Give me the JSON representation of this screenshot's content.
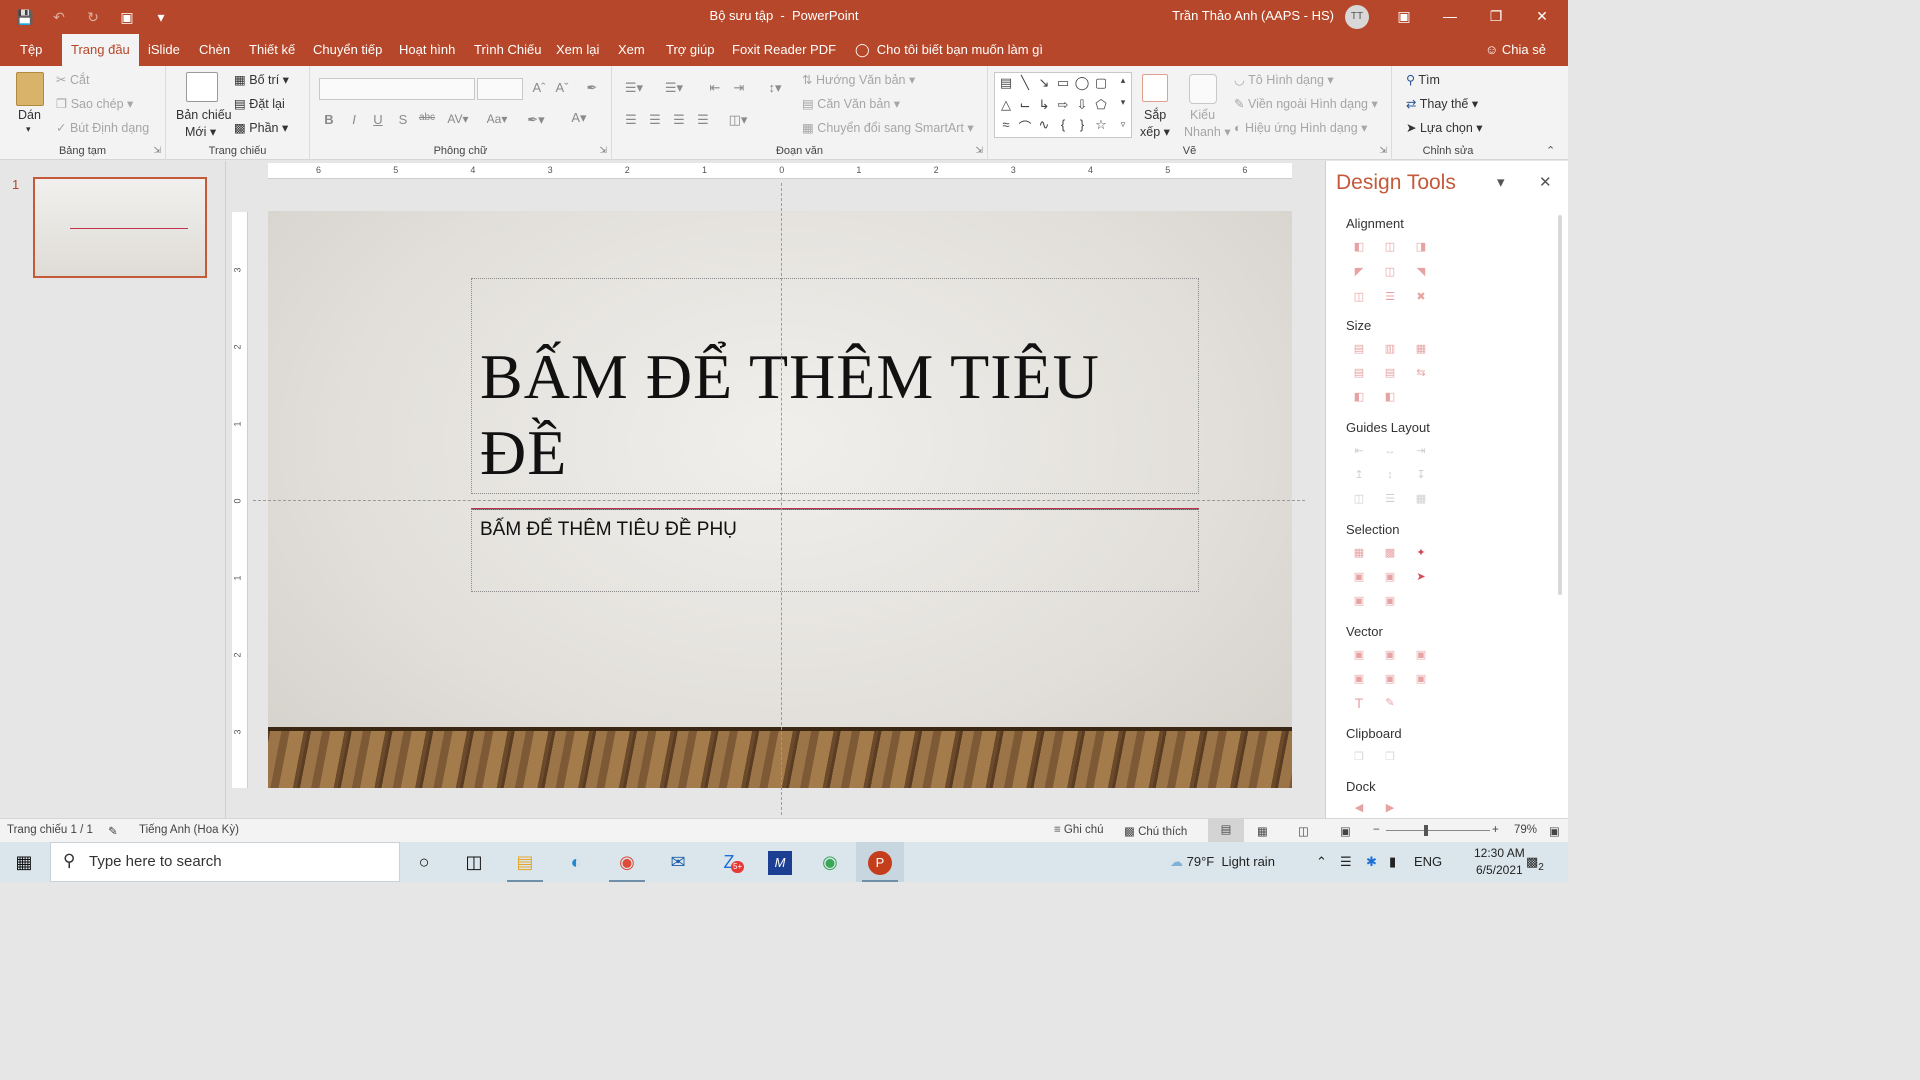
{
  "window": {
    "doc_title": "Bộ sưu tập",
    "app_name": "PowerPoint",
    "title_sep": "  -  ",
    "user_name": "Trần Thảo Anh (AAPS - HS)",
    "user_initials": "TT"
  },
  "tabs": [
    "Tệp",
    "Trang đầu",
    "iSlide",
    "Chèn",
    "Thiết kế",
    "Chuyển tiếp",
    "Hoạt hình",
    "Trình Chiếu",
    "Xem lại",
    "Xem",
    "Trợ giúp",
    "Foxit Reader PDF"
  ],
  "active_tab": "Trang đầu",
  "tell_me": "Cho tôi biết bạn muốn làm gì",
  "share": "Chia sẻ",
  "ribbon": {
    "clipboard": {
      "label": "Bảng tạm",
      "paste": "Dán",
      "cut": "Cắt",
      "copy": "Sao chép",
      "format_painter": "Bút Định dạng"
    },
    "slides": {
      "label": "Trang chiếu",
      "new_slide_1": "Bản chiếu",
      "new_slide_2": "Mới",
      "layout": "Bố trí",
      "reset": "Đặt lại",
      "section": "Phần"
    },
    "font": {
      "label": "Phông chữ"
    },
    "paragraph": {
      "label": "Đoạn văn",
      "text_direction": "Hướng Văn bản",
      "align_text": "Căn Văn bản",
      "smartart": "Chuyển đổi sang SmartArt"
    },
    "drawing": {
      "label": "Vẽ",
      "arrange_1": "Sắp",
      "arrange_2": "xếp",
      "quick_styles_1": "Kiểu",
      "quick_styles_2": "Nhanh",
      "shape_fill": "Tô Hình dạng",
      "shape_outline": "Viền ngoài Hình dạng",
      "shape_effects": "Hiệu ứng Hình dạng"
    },
    "editing": {
      "label": "Chỉnh sửa",
      "find": "Tìm",
      "replace": "Thay thế",
      "select": "Lựa chọn"
    }
  },
  "thumbnails": [
    {
      "number": "1"
    }
  ],
  "slide": {
    "title": "BẤM ĐỂ THÊM TIÊU ĐỀ",
    "subtitle": "BẤM ĐỂ THÊM TIÊU ĐỀ PHỤ"
  },
  "rulers": {
    "horizontal": [
      "6",
      "5",
      "4",
      "3",
      "2",
      "1",
      "0",
      "1",
      "2",
      "3",
      "4",
      "5",
      "6"
    ],
    "vertical": [
      "3",
      "2",
      "1",
      "0",
      "1",
      "2",
      "3"
    ]
  },
  "design_tools": {
    "title": "Design Tools",
    "sections": [
      "Alignment",
      "Size",
      "Guides Layout",
      "Selection",
      "Vector",
      "Clipboard",
      "Dock"
    ]
  },
  "status": {
    "slide_count": "Trang chiếu 1 / 1",
    "language": "Tiếng Anh (Hoa Kỳ)",
    "notes": "Ghi chú",
    "comments": "Chú thích",
    "zoom_percent": "79%"
  },
  "taskbar": {
    "search_placeholder": "Type here to search",
    "weather": "79°F  Light rain",
    "lang": "ENG",
    "time": "12:30 AM",
    "date": "6/5/2021",
    "notification_count": "2",
    "zalo_badge": "5+"
  },
  "colors": {
    "accent": "#b7472a",
    "title_text": "#111111",
    "accent_line": "#c0344b"
  }
}
